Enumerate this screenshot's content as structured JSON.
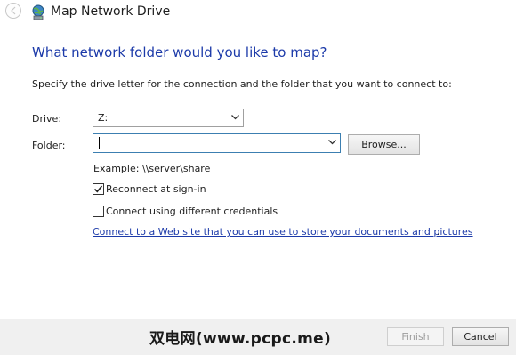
{
  "window": {
    "title": "Map Network Drive"
  },
  "heading": "What network folder would you like to map?",
  "instruction": "Specify the drive letter for the connection and the folder that you want to connect to:",
  "drive": {
    "label": "Drive:",
    "value": "Z:"
  },
  "folder": {
    "label": "Folder:",
    "value": "",
    "browse_label": "Browse..."
  },
  "example_text": "Example: \\\\server\\share",
  "reconnect": {
    "label": "Reconnect at sign-in",
    "checked": true
  },
  "different_credentials": {
    "label": "Connect using different credentials",
    "checked": false
  },
  "web_link": {
    "text": "Connect to a Web site that you can use to store your documents and pictures",
    "suffix": "."
  },
  "buttons": {
    "finish": "Finish",
    "cancel": "Cancel"
  },
  "watermark": "双电网(www.pcpc.me)",
  "colors": {
    "heading": "#1c3aa9",
    "link": "#1c3aa9",
    "footer_bg": "#f0f0f0"
  },
  "icons": {
    "back": "back-arrow-icon",
    "window": "network-drive-globe-icon"
  }
}
